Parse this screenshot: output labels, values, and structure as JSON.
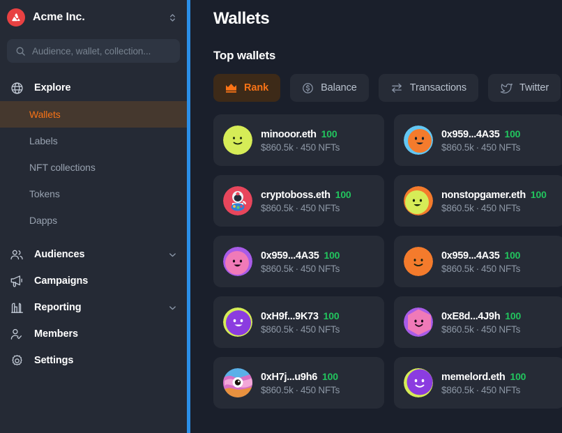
{
  "sidebar": {
    "org": {
      "name": "Acme Inc.",
      "logo_icon": "avalanche-logo-icon",
      "switcher_icon": "chevron-up-down-icon",
      "logo_color": "#e84142"
    },
    "search": {
      "placeholder": "Audience, wallet, collection...",
      "value": "",
      "icon": "search-icon"
    },
    "groups": [
      {
        "label": "Explore",
        "icon": "globe-icon",
        "expanded": true,
        "has_caret": false,
        "items": [
          {
            "label": "Wallets",
            "active": true
          },
          {
            "label": "Labels",
            "active": false
          },
          {
            "label": "NFT collections",
            "active": false
          },
          {
            "label": "Tokens",
            "active": false
          },
          {
            "label": "Dapps",
            "active": false
          }
        ]
      },
      {
        "label": "Audiences",
        "icon": "users-icon",
        "has_caret": true,
        "items": []
      },
      {
        "label": "Campaigns",
        "icon": "megaphone-icon",
        "has_caret": false,
        "items": []
      },
      {
        "label": "Reporting",
        "icon": "bar-chart-icon",
        "has_caret": true,
        "items": []
      },
      {
        "label": "Members",
        "icon": "user-check-icon",
        "has_caret": false,
        "items": []
      },
      {
        "label": "Settings",
        "icon": "gear-icon",
        "has_caret": false,
        "items": []
      }
    ],
    "active_item_bg": "#45382e",
    "active_item_color": "#f97316"
  },
  "divider": {
    "name": "sidebar-resize-handle",
    "color": "#2b8fe8"
  },
  "main": {
    "page_title": "Wallets",
    "section_title": "Top wallets",
    "tabs": [
      {
        "label": "Rank",
        "icon": "crown-icon",
        "active": true
      },
      {
        "label": "Balance",
        "icon": "dollar-circle-icon",
        "active": false
      },
      {
        "label": "Transactions",
        "icon": "transfer-arrows-icon",
        "active": false
      },
      {
        "label": "Twitter",
        "icon": "twitter-bird-icon",
        "active": false
      }
    ],
    "accent_color": "#f97316",
    "score_color": "#22c55e",
    "wallets": [
      {
        "name": "minooor.eth",
        "score": "100",
        "balance": "$860.5k",
        "nfts": "450 NFTs",
        "avatar": "face-lime"
      },
      {
        "name": "0x959...4A35",
        "score": "100",
        "balance": "$860.5k",
        "nfts": "450 NFTs",
        "avatar": "face-orange-blue"
      },
      {
        "name": "cryptoboss.eth",
        "score": "100",
        "balance": "$860.5k",
        "nfts": "450 NFTs",
        "avatar": "nft-astronaut"
      },
      {
        "name": "nonstopgamer.eth",
        "score": "100",
        "balance": "$860.5k",
        "nfts": "450 NFTs",
        "avatar": "face-lime-orange"
      },
      {
        "name": "0x959...4A35",
        "score": "100",
        "balance": "$860.5k",
        "nfts": "450 NFTs",
        "avatar": "face-pink-purple"
      },
      {
        "name": "0x959...4A35",
        "score": "100",
        "balance": "$860.5k",
        "nfts": "450 NFTs",
        "avatar": "face-orange"
      },
      {
        "name": "0xH9f...9K73",
        "score": "100",
        "balance": "$860.5k",
        "nfts": "450 NFTs",
        "avatar": "face-purple-lime"
      },
      {
        "name": "0xE8d...4J9h",
        "score": "100",
        "balance": "$860.5k",
        "nfts": "450 NFTs",
        "avatar": "face-pink-purple2"
      },
      {
        "name": "0xH7j...u9h6",
        "score": "100",
        "balance": "$860.5k",
        "nfts": "450 NFTs",
        "avatar": "nft-eye-donut"
      },
      {
        "name": "memelord.eth",
        "score": "100",
        "balance": "$860.5k",
        "nfts": "450 NFTs",
        "avatar": "face-purple-lime2"
      }
    ],
    "separator": "·"
  }
}
